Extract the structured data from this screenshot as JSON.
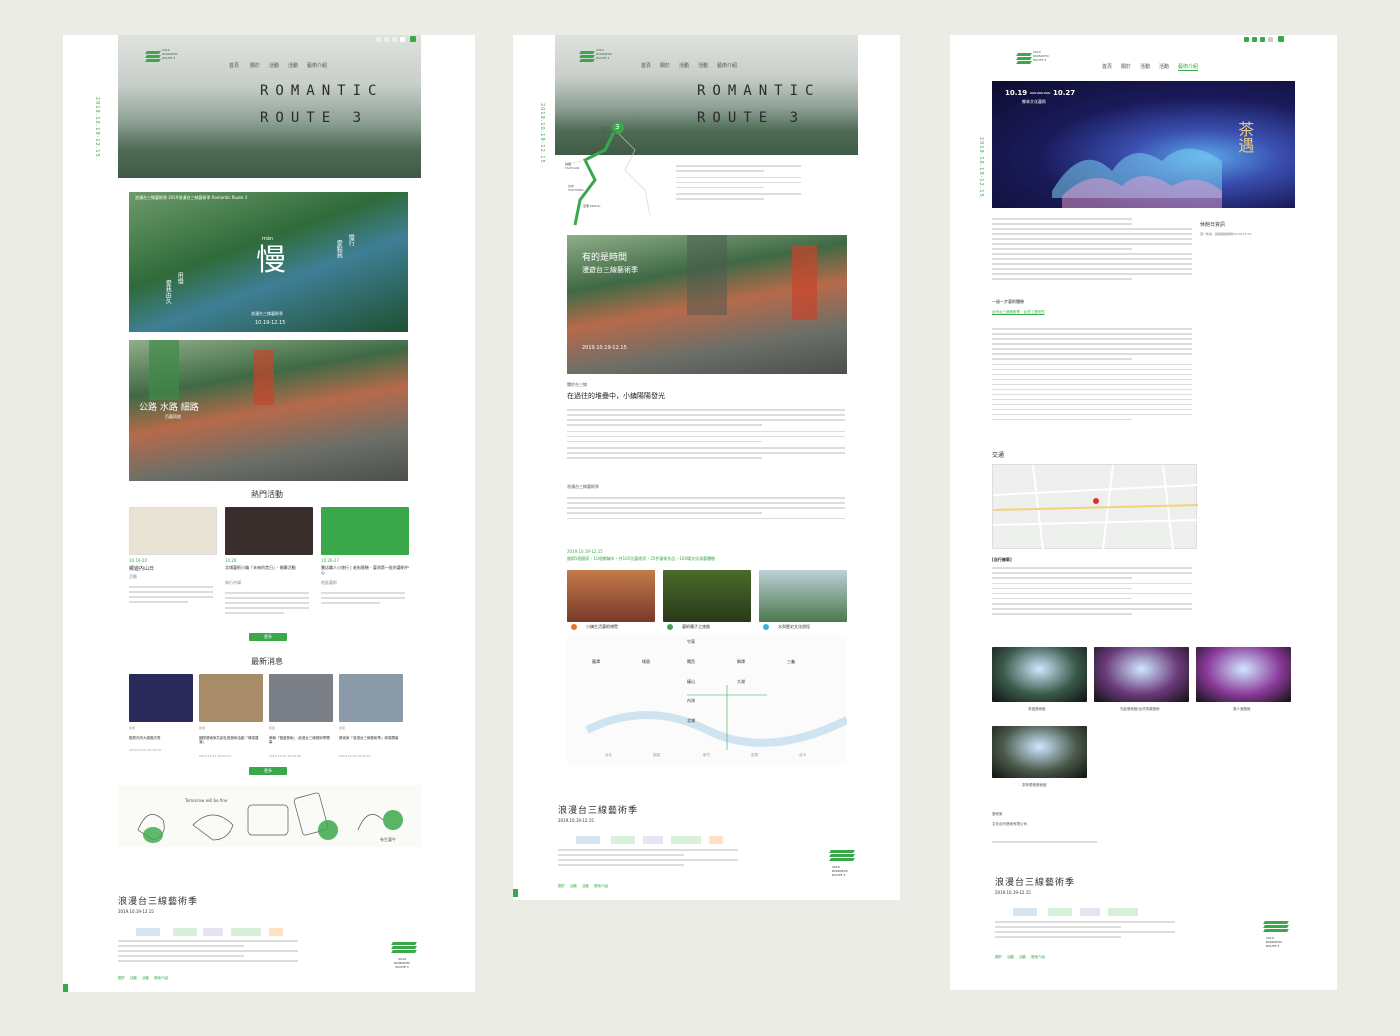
{
  "nav": [
    "首頁",
    "關於",
    "活動",
    "活動",
    "藝術介紹"
  ],
  "brand": {
    "logo_line1": "2019",
    "logo_line2": "ROMANTIC",
    "logo_line3": "ROUTE 3",
    "logo_line4": "DOCUMENT"
  },
  "side_date": "2019.10.19-12.15",
  "hero_title_1": "ROMANTIC",
  "hero_title_2": "ROUTE 3",
  "panel1": {
    "poster1_caption": "浪漫台三線藝術季 2019浪漫台三線藝術季 Romantic Route 3",
    "poster1_big": "慢",
    "poster1_pinyin": "màn",
    "poster1_side_left": "愛我由久",
    "poster1_side_left2": "用慢",
    "poster1_side_right": "慢行",
    "poster1_side_right2": "愛點我",
    "poster1_event": "浪漫台三線藝術季",
    "poster1_date": "10.19-12.15",
    "poster2_title": "公路 水路 細路",
    "poster2_sub": "百藝齊放",
    "hot_title": "熱門活動",
    "hot_items": [
      {
        "date": "10.19-20",
        "title": "鄉遊內山日",
        "tag": "活動",
        "img": "#e9e3d6"
      },
      {
        "date": "10.26",
        "title": "北埔藝術小鎮「未來的昔日」- 開幕活動",
        "tag": "執行內場",
        "img": "#3a2e2c"
      },
      {
        "date": "10.26-27",
        "title": "書店職人小旅行 | 老街實驗 - 臺灣第一批的藝術中心",
        "tag": "地區藝術",
        "img": "#3aa84a"
      }
    ],
    "more": "更多",
    "news_title": "最新消息",
    "news_items": [
      {
        "tag": "新聞",
        "title": "歡慶內灣大橋燈光秀",
        "date": "2019-11-01 16:45:19",
        "img": "#2a2a5a"
      },
      {
        "tag": "新聞",
        "title": "國際藝術家共創社區藝術活動「情感展演」",
        "date": "2019-11-27 18:03:13",
        "img": "#a88c6a"
      },
      {
        "tag": "新聞",
        "title": "串聯「慢遊藝術」-浪漫台三線藝術季開幕",
        "date": "2019-11-01 16:29:08",
        "img": "#7a7f88"
      },
      {
        "tag": "新聞",
        "title": "藝術家「浪漫台三線藝術季」即將開幕",
        "date": "2019-11-04 16:25:27",
        "img": "#8a9aa8"
      }
    ],
    "comic_caption": "Tomorrow will be fine",
    "comic_end": "有生藝牛",
    "footer_title": "浪漫台三線藝術季",
    "footer_date": "2019.10.19-12.15",
    "footer_links": [
      "關於",
      "活動",
      "活動",
      "藝術介紹"
    ]
  },
  "panel2": {
    "map_labels": [
      "新竹 HSINCHU",
      "台中 TAICHUNG",
      "桃園 TAOYUAN",
      "苗栗 MIAOLI"
    ],
    "map_number": "3",
    "intro_lines": 4,
    "photo_title": "有的是時間",
    "photo_sub": "漫遊台三線藝術季",
    "photo_date": "2019.10.19-12.15",
    "about_label": "關於台三線",
    "about_title": "在過往的堆疊中，小鎮陽陽發光",
    "section_label": "浪漫台三線藝術季",
    "highlight_1": "2019.10.19-12.15",
    "highlight_2": "國際5個國家・10個鄉鎮市・共105位藝術家・35件藝術作品・100場文化演藝體驗",
    "feature_items": [
      "小鎮生活藝術博覽",
      "藝術種子之旅路",
      "水與歷史文化遊徑"
    ],
    "feature_colors": [
      "#e6702c",
      "#3aa84a",
      "#3ab0e6"
    ],
    "route_towns": [
      "竹東",
      "峨眉",
      "關西",
      "獅潭",
      "三義",
      "大湖",
      "龍潭",
      "內灣",
      "北埔",
      "橫山"
    ],
    "axis_labels": [
      "台北",
      "桃園",
      "新竹",
      "苗栗",
      "台中"
    ],
    "footer_title": "浪漫台三線藝術季",
    "footer_date": "2019.10.19-12.15",
    "footer_links": [
      "關於",
      "活動",
      "活動",
      "藝術介紹"
    ]
  },
  "panel3": {
    "poster_date": "10.19 ——— 10.27",
    "poster_place": "鄉林文化藝術",
    "poster_big": "茶遇",
    "info_title": "休館日資訊",
    "info_text": "週一休館，其他開放時間09:00-17:00",
    "link_label": "一級一步藝術體驗",
    "link_text": "台灣台三線藝術季・台灣工藝研究",
    "transport_title": "交通",
    "extra_title": "[自行開車]",
    "galleries": [
      {
        "caption": "茶遊藝術館",
        "img": "#3a5a4a"
      },
      {
        "caption": "光影藝術館/台灣茶葉藝術",
        "img": "#6a3a7a"
      },
      {
        "caption": "藝人演藝館",
        "img": "#8a3a9a"
      },
      {
        "caption": "茶林優雅藝術館",
        "img": "#4a5a4a"
      }
    ],
    "credit_label": "藝術家",
    "credit_text": "文化台灣藝術有限公司",
    "footer_title": "浪漫台三線藝術季",
    "footer_date": "2019.10.19-12.15",
    "footer_links": [
      "關於",
      "活動",
      "活動",
      "藝術介紹"
    ]
  },
  "sponsors": [
    "客家委員會",
    "桃園市政府",
    "新竹縣政府",
    "苗栗縣政府"
  ]
}
